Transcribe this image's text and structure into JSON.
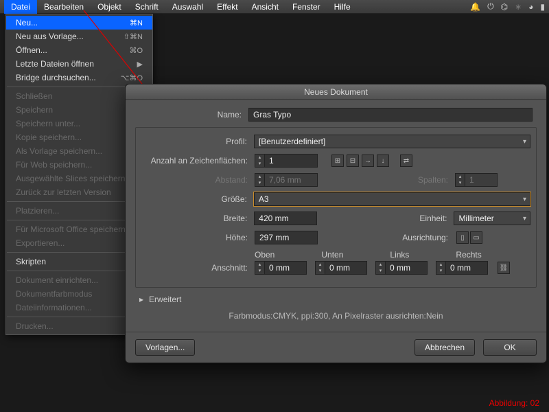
{
  "menubar": {
    "items": [
      "Datei",
      "Bearbeiten",
      "Objekt",
      "Schrift",
      "Auswahl",
      "Effekt",
      "Ansicht",
      "Fenster",
      "Hilfe"
    ]
  },
  "dropdown": {
    "neu": "Neu...",
    "neu_sc": "⌘N",
    "vorlage": "Neu aus Vorlage...",
    "vorlage_sc": "⇧⌘N",
    "oeffnen": "Öffnen...",
    "oeffnen_sc": "⌘O",
    "letzte": "Letzte Dateien öffnen",
    "bridge": "Bridge durchsuchen...",
    "bridge_sc": "⌥⌘O",
    "schliessen": "Schließen",
    "speichern": "Speichern",
    "speichern_unter": "Speichern unter...",
    "kopie": "Kopie speichern...",
    "als_vorlage": "Als Vorlage speichern...",
    "fuer_web": "Für Web speichern...",
    "slices": "Ausgewählte Slices speichern...",
    "zurueck": "Zurück zur letzten Version",
    "platzieren": "Platzieren...",
    "ms_office": "Für Microsoft Office speichern...",
    "export": "Exportieren...",
    "skripten": "Skripten",
    "einrichten": "Dokument einrichten...",
    "farbmodus": "Dokumentfarbmodus",
    "dateiinfo": "Dateiinformationen...",
    "drucken": "Drucken..."
  },
  "dialog": {
    "title": "Neues Dokument",
    "name_lbl": "Name:",
    "name_val": "Gras Typo",
    "profil_lbl": "Profil:",
    "profil_val": "[Benutzerdefiniert]",
    "artboards_lbl": "Anzahl an Zeichenflächen:",
    "artboards_val": "1",
    "abstand_lbl": "Abstand:",
    "abstand_val": "7,06 mm",
    "spalten_lbl": "Spalten:",
    "spalten_val": "1",
    "groesse_lbl": "Größe:",
    "groesse_val": "A3",
    "breite_lbl": "Breite:",
    "breite_val": "420 mm",
    "einheit_lbl": "Einheit:",
    "einheit_val": "Millimeter",
    "hoehe_lbl": "Höhe:",
    "hoehe_val": "297 mm",
    "ausrichtung_lbl": "Ausrichtung:",
    "anschnitt_lbl": "Anschnitt:",
    "oben": "Oben",
    "unten": "Unten",
    "links": "Links",
    "rechts": "Rechts",
    "bleed_val": "0 mm",
    "erweitert": "Erweitert",
    "summary": "Farbmodus:CMYK, ppi:300, An Pixelraster ausrichten:Nein",
    "vorlagen": "Vorlagen...",
    "abbrechen": "Abbrechen",
    "ok": "OK"
  },
  "figure": "Abbildung: 02"
}
